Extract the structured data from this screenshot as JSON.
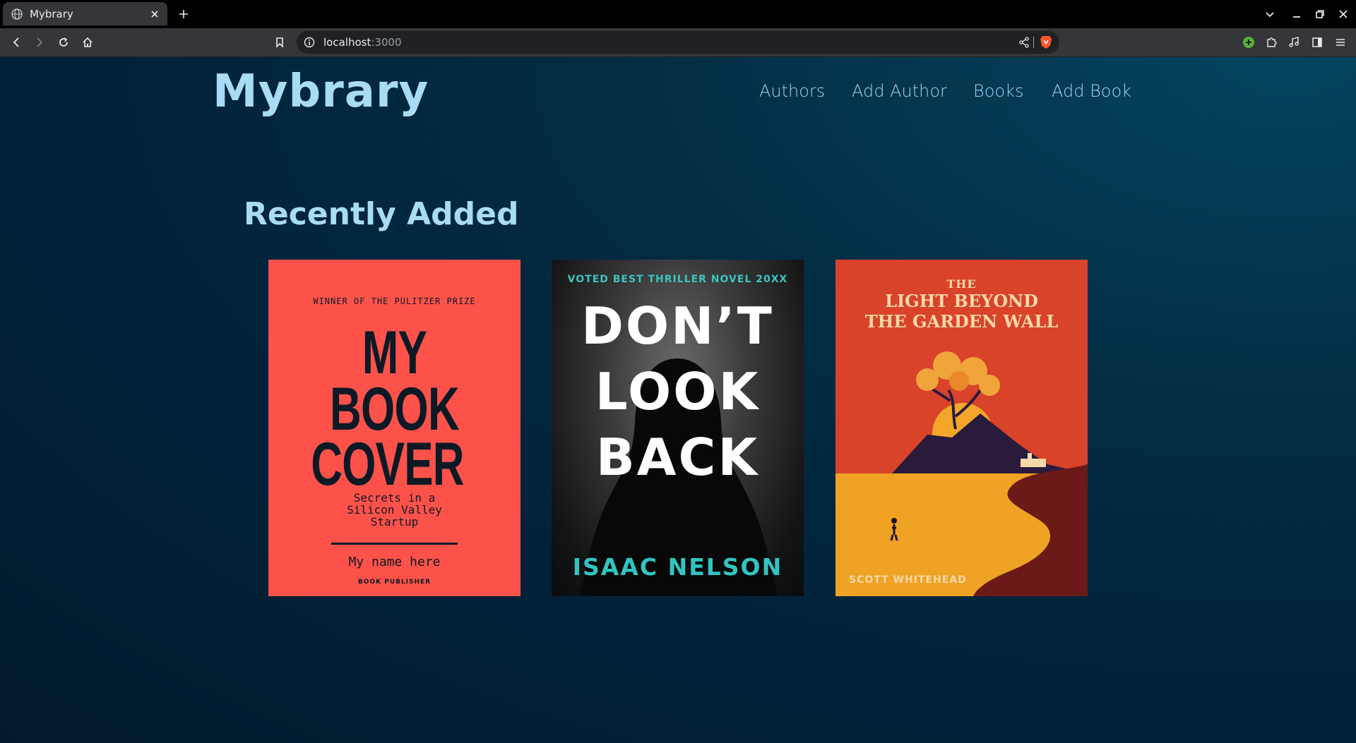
{
  "browser": {
    "tab_title": "Mybrary",
    "url_host": "localhost",
    "url_port": ":3000"
  },
  "site": {
    "logo": "Mybrary",
    "nav": [
      "Authors",
      "Add Author",
      "Books",
      "Add Book"
    ]
  },
  "main": {
    "section_title": "Recently Added",
    "books": [
      {
        "tag": "WINNER OF THE PULITZER PRIZE",
        "title_lines": [
          "MY",
          "BOOK",
          "COVER"
        ],
        "subtitle_lines": [
          "Secrets in a",
          "Silicon Valley",
          "Startup"
        ],
        "author": "My name here",
        "publisher": "BOOK PUBLISHER"
      },
      {
        "tag": "VOTED BEST THRILLER NOVEL 20XX",
        "title_lines": [
          "DON’T",
          "LOOK",
          "BACK"
        ],
        "author": "ISAAC NELSON"
      },
      {
        "title_lines": [
          "THE",
          "LIGHT BEYOND",
          "THE GARDEN WALL"
        ],
        "author": "SCOTT WHITEHEAD"
      }
    ]
  },
  "colors": {
    "page_bg": "#032d44",
    "accent": "#a7dcf4",
    "cover1_bg": "#fd524a",
    "cover3_bg": "#d9432a",
    "teal": "#32c4c1"
  },
  "icons": {
    "chrome": [
      "globe-icon",
      "close-icon",
      "plus-icon",
      "chevron-down-icon",
      "minimize-icon",
      "restore-icon",
      "back-icon",
      "forward-icon",
      "reload-icon",
      "home-icon",
      "bookmark-icon",
      "info-icon",
      "share-icon",
      "brave-shield-icon",
      "extension-icon",
      "puzzle-icon",
      "music-icon",
      "sidebar-icon",
      "menu-icon"
    ]
  }
}
